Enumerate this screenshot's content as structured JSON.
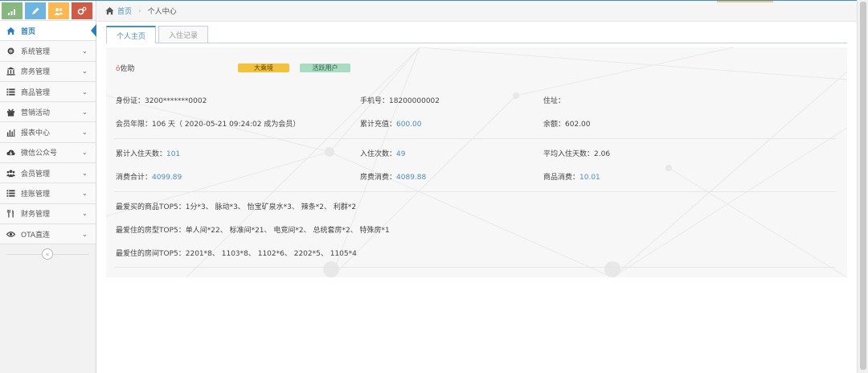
{
  "colors": {
    "accent": "#4c8fbd",
    "shortcut_green": "#87b87f",
    "shortcut_blue": "#6fb3e0",
    "shortcut_orange": "#ffb752",
    "shortcut_red": "#d15b47",
    "badge_yellow": "#f3c23f",
    "badge_green": "#a9dcc0"
  },
  "shortcuts": [
    {
      "icon": "signal-icon",
      "color": "#87b87f"
    },
    {
      "icon": "pencil-icon",
      "color": "#6fb3e0"
    },
    {
      "icon": "users-icon",
      "color": "#ffb752"
    },
    {
      "icon": "cogs-icon",
      "color": "#d15b47"
    }
  ],
  "sidebar": {
    "items": [
      {
        "label": "首页",
        "icon": "home-icon",
        "active": true
      },
      {
        "label": "系统管理",
        "icon": "gear-icon"
      },
      {
        "label": "房务管理",
        "icon": "bank-icon"
      },
      {
        "label": "商品管理",
        "icon": "list-icon"
      },
      {
        "label": "营销活动",
        "icon": "gift-icon"
      },
      {
        "label": "报表中心",
        "icon": "bar-chart-icon"
      },
      {
        "label": "微信公众号",
        "icon": "cloud-icon"
      },
      {
        "label": "会员管理",
        "icon": "group-icon"
      },
      {
        "label": "挂账管理",
        "icon": "list-icon"
      },
      {
        "label": "财务管理",
        "icon": "cutlery-icon"
      },
      {
        "label": "OTA直连",
        "icon": "eye-icon"
      }
    ],
    "collapse_icon": "double-chevron-left-icon"
  },
  "breadcrumb": {
    "home": "首页",
    "current": "个人中心"
  },
  "tabs": [
    {
      "label": "个人主页",
      "active": true
    },
    {
      "label": "入住记录",
      "active": false
    }
  ],
  "profile": {
    "name": "佐助",
    "badges": [
      "大乘境",
      "活跃用户"
    ],
    "id_label": "身份证：",
    "id_value": "3200*******0002",
    "phone_label": "手机号：",
    "phone_value": "18200000002",
    "address_label": "住址：",
    "address_value": "",
    "member_label": "会员年限：",
    "member_value": "106 天（ 2020-05-21 09:24:02 成为会员）",
    "recharge_label": "累计充值：",
    "recharge_value": "600.00",
    "balance_label": "余额：",
    "balance_value": "602.00",
    "stay_days_label": "累计入住天数：",
    "stay_days_value": "101",
    "stay_count_label": "入住次数：",
    "stay_count_value": "49",
    "avg_days_label": "平均入住天数：",
    "avg_days_value": "2.06",
    "spend_total_label": "消费合计：",
    "spend_total_value": "4099.89",
    "room_spend_label": "房费消费：",
    "room_spend_value": "4089.88",
    "goods_spend_label": "商品消费：",
    "goods_spend_value": "10.01",
    "top_goods_label": "最爱买的商品TOP5：",
    "top_goods_value": "1分*3、 脉动*3、 怡宝矿泉水*3、 辣条*2、 利群*2",
    "top_roomtype_label": "最爱住的房型TOP5：",
    "top_roomtype_value": "单人间*22、 标准间*21、 电竞间*2、 总统套房*2、 特殊房*1",
    "top_room_label": "最爱住的房间TOP5：",
    "top_room_value": "2201*8、 1103*8、 1102*6、 2202*5、 1105*4"
  }
}
